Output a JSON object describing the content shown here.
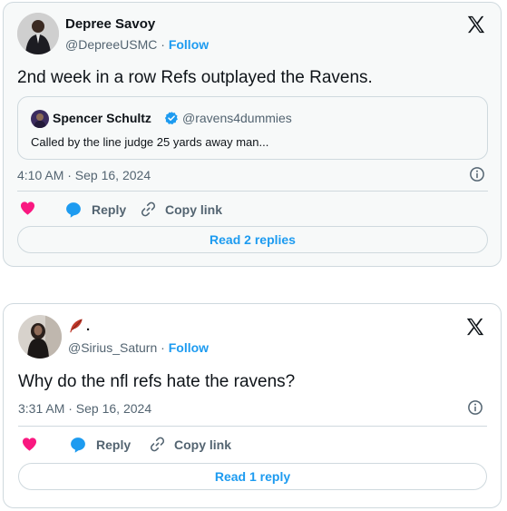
{
  "tweets": [
    {
      "author_name": "Depree Savoy",
      "handle": "@DepreeUSMC",
      "separator": "·",
      "follow_label": "Follow",
      "text": "2nd week in a row Refs outplayed the Ravens.",
      "quote": {
        "author_name": "Spencer Schultz",
        "handle": "@ravens4dummies",
        "text": "Called by the line judge 25 yards away man..."
      },
      "timestamp": "4:10 AM · Sep 16, 2024",
      "reply_label": "Reply",
      "copy_link_label": "Copy link",
      "read_replies_label": "Read 2 replies"
    },
    {
      "author_name": ".",
      "handle": "@Sirius_Saturn",
      "separator": "·",
      "follow_label": "Follow",
      "text": "Why do the nfl refs hate the ravens?",
      "timestamp": "3:31 AM · Sep 16, 2024",
      "reply_label": "Reply",
      "copy_link_label": "Copy link",
      "read_replies_label": "Read 1 reply"
    }
  ],
  "icons": {
    "x_logo": "x-logo-icon",
    "verified": "verified-badge-icon",
    "info": "info-icon",
    "like": "heart-icon",
    "reply": "reply-bubble-icon",
    "copy_link": "link-icon",
    "name_emoji": "feather-icon"
  },
  "colors": {
    "like": "#f91880",
    "reply": "#1d9bf0",
    "link": "#1d9bf0",
    "verified": "#1d9bf0",
    "secondary_text": "#536471",
    "border": "#cfd9de"
  }
}
